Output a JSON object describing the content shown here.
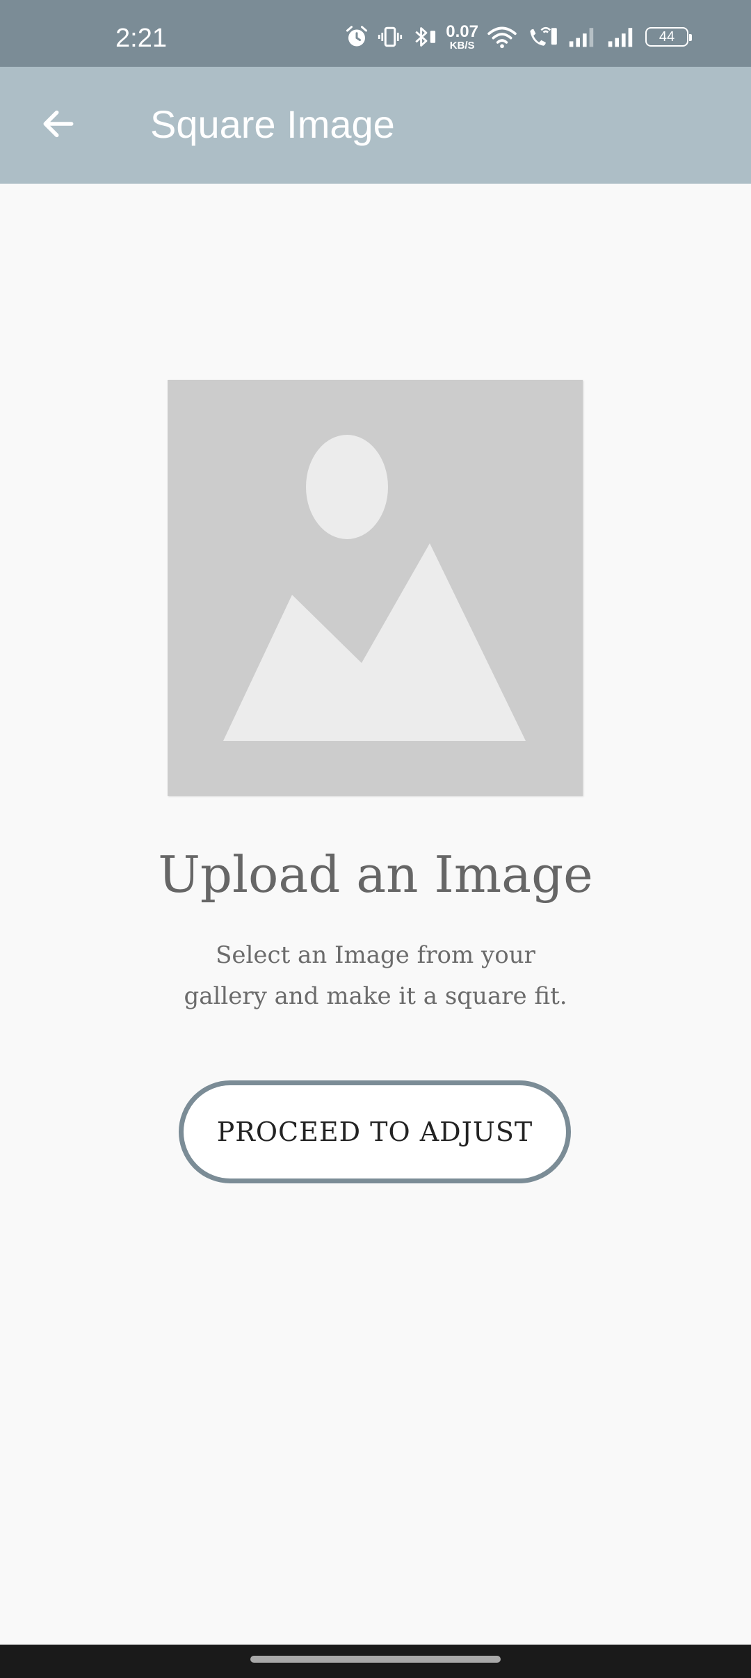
{
  "status_bar": {
    "time": "2:21",
    "net_speed_value": "0.07",
    "net_speed_unit": "KB/S",
    "battery": "44",
    "icons": [
      "alarm-icon",
      "vibrate-icon",
      "bluetooth-icon",
      "wifi-icon",
      "wifi-calling-icon",
      "signal-icon",
      "signal-icon"
    ]
  },
  "app_bar": {
    "back_icon": "arrow-left-icon",
    "title": "Square Image"
  },
  "main": {
    "placeholder_icon": "image-placeholder-icon",
    "heading": "Upload an Image",
    "description_line1": "Select an Image from your",
    "description_line2": "gallery and make it a square fit.",
    "button_label": "PROCEED TO ADJUST"
  },
  "colors": {
    "status_bar": "#7b8c96",
    "app_bar": "#adbec6",
    "background": "#f9f9f9",
    "button_border": "#7b8c96",
    "placeholder_bg": "#cccccc",
    "placeholder_shapes": "#ececec"
  }
}
